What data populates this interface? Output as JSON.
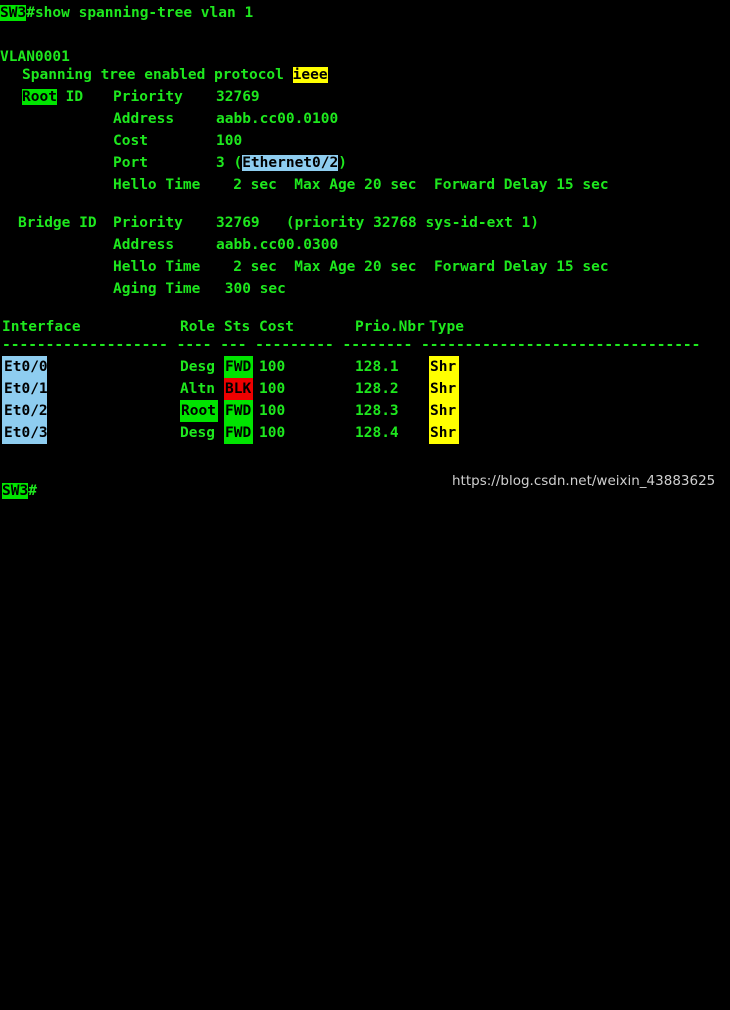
{
  "terminal": {
    "device_prompt": "SW3",
    "prompt_symbol": "#",
    "command": "show spanning-tree vlan 1",
    "vlan_header": "VLAN0001",
    "spanning_tree_line": {
      "label": "Spanning tree enabled protocol ",
      "protocol": "ieee"
    },
    "root_id": {
      "title": "Root",
      "title_suffix": " ID",
      "priority_label": "Priority",
      "priority_value": "32769",
      "address_label": "Address",
      "address_value": "aabb.cc00.0100",
      "cost_label": "Cost",
      "cost_value": "100",
      "port_label": "Port",
      "port_number": "3 (",
      "port_interface": "Ethernet0/2",
      "port_close": ")",
      "hello_label": "Hello Time",
      "hello_value": "   2 sec  Max Age 20 sec  Forward Delay 15 sec"
    },
    "bridge_id": {
      "title": "Bridge ID",
      "priority_label": "Priority",
      "priority_value": "32769   (priority 32768 sys-id-ext 1)",
      "address_label": "Address",
      "address_value": "aabb.cc00.0300",
      "hello_label": "Hello Time",
      "hello_value": "   2 sec  Max Age 20 sec  Forward Delay 15 sec",
      "aging_label": "Aging Time",
      "aging_value": " 300 sec"
    },
    "table": {
      "headers": {
        "interface": "Interface",
        "role": "Role",
        "sts": "Sts",
        "cost": "Cost",
        "prio_nbr": "Prio.Nbr",
        "type": "Type"
      },
      "separator": "------------------- ---- --- --------- -------- --------------------------------",
      "rows": [
        {
          "interface": "Et0/0",
          "role": "Desg",
          "sts": "FWD",
          "cost": "100",
          "prio_nbr": "128.1",
          "type": "Shr"
        },
        {
          "interface": "Et0/1",
          "role": "Altn",
          "sts": "BLK",
          "cost": "100",
          "prio_nbr": "128.2",
          "type": "Shr"
        },
        {
          "interface": "Et0/2",
          "role": "Root",
          "sts": "FWD",
          "cost": "100",
          "prio_nbr": "128.3",
          "type": "Shr"
        },
        {
          "interface": "Et0/3",
          "role": "Desg",
          "sts": "FWD",
          "cost": "100",
          "prio_nbr": "128.4",
          "type": "Shr"
        }
      ]
    },
    "final_prompt": "SW3",
    "final_prompt_symbol": "#"
  },
  "watermark": {
    "text": "https://blog.csdn.net/weixin_43883625"
  },
  "colors": {
    "background": "#000000",
    "text_green": "#1ee81e",
    "highlight_green": "#00e400",
    "highlight_yellow": "#ffff00",
    "highlight_red": "#ee0000",
    "highlight_blue": "#8ecdf0",
    "watermark_gray": "#cfcfcf"
  }
}
